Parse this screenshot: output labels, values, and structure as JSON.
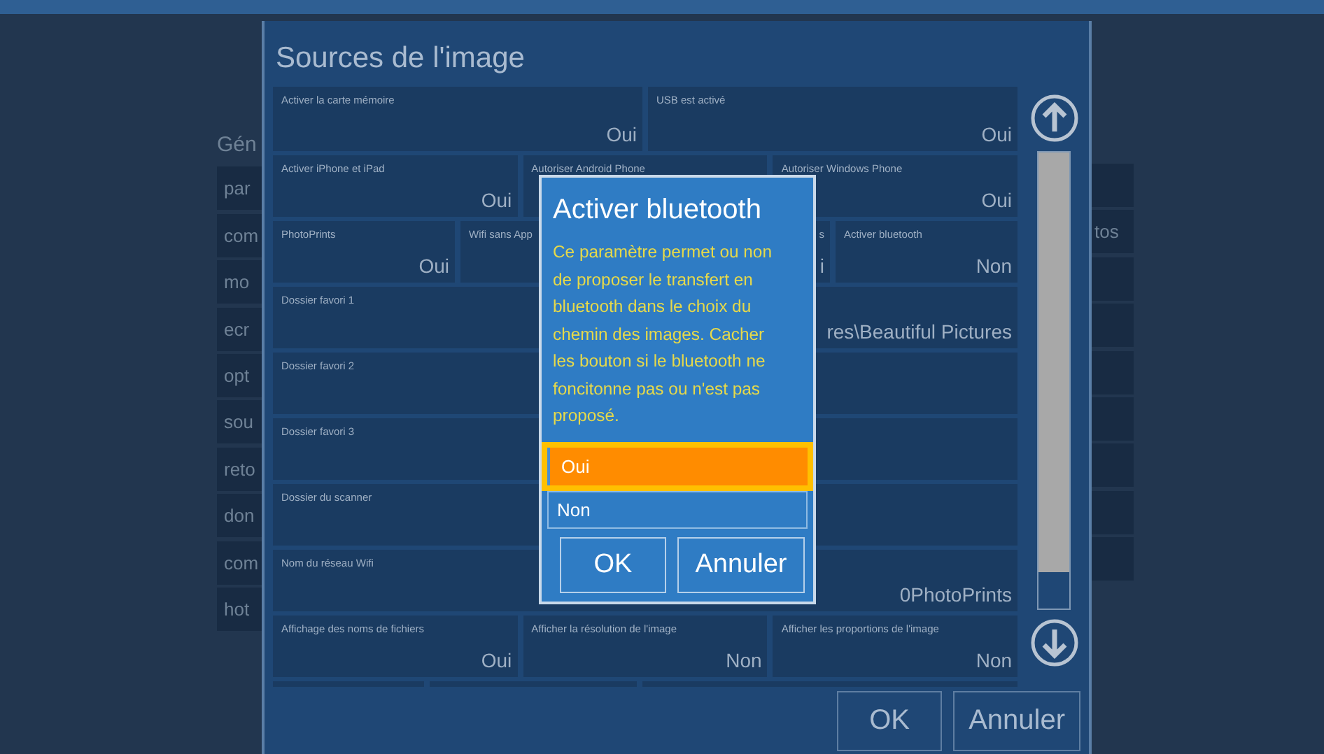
{
  "background_app": {
    "heading": "Gén",
    "menu_items": [
      "par",
      "com",
      "mo",
      "ecr",
      "opt",
      "sou",
      "reto",
      "don",
      "com",
      "hot"
    ],
    "right_tile_label": "tos"
  },
  "dialog": {
    "title": "Sources de l'image",
    "sections": [
      {
        "tiles": [
          {
            "label": "Activer la carte mémoire",
            "value": "Oui"
          },
          {
            "label": "USB est activé",
            "value": "Oui"
          }
        ]
      },
      {
        "tiles": [
          {
            "label": "Activer iPhone et iPad",
            "value": "Oui"
          },
          {
            "label": "Autoriser Android Phone"
          },
          {
            "label": "Autoriser Windows Phone",
            "value": "Oui"
          }
        ]
      },
      {
        "tiles": [
          {
            "label": "PhotoPrints",
            "value": "Oui"
          },
          {
            "label": "Wifi sans App"
          },
          {
            "kind": "covered",
            "label": "s",
            "value": "i"
          },
          {
            "label": "Activer bluetooth",
            "value": "Non"
          }
        ]
      },
      {
        "tiles": [
          {
            "label": "Dossier favori 1",
            "value": "res\\Beautiful Pictures"
          }
        ]
      },
      {
        "tiles": [
          {
            "label": "Dossier favori 2"
          }
        ]
      },
      {
        "tiles": [
          {
            "label": "Dossier favori 3"
          }
        ]
      },
      {
        "tiles": [
          {
            "label": "Dossier du scanner"
          }
        ]
      },
      {
        "tiles": [
          {
            "label": "Nom du réseau Wifi",
            "value": "0PhotoPrints"
          }
        ]
      },
      {
        "tiles": [
          {
            "label": "Affichage des noms de fichiers",
            "value": "Oui"
          },
          {
            "label": "Afficher la résolution de l'image",
            "value": "Non"
          },
          {
            "label": "Afficher les proportions de l'image",
            "value": "Non"
          }
        ]
      }
    ],
    "buttons": [
      "OK",
      "Annuler"
    ]
  },
  "modal": {
    "title": "Activer bluetooth",
    "description": "Ce paramètre permet ou non de proposer le transfert en bluetooth dans le choix du chemin des images. Cacher les bouton si le bluetooth ne foncitonne pas ou n'est pas proposé.",
    "options": [
      {
        "label": "Oui",
        "selected": true
      },
      {
        "label": "Non",
        "selected": false
      }
    ],
    "buttons": [
      "OK",
      "Annuler"
    ]
  }
}
